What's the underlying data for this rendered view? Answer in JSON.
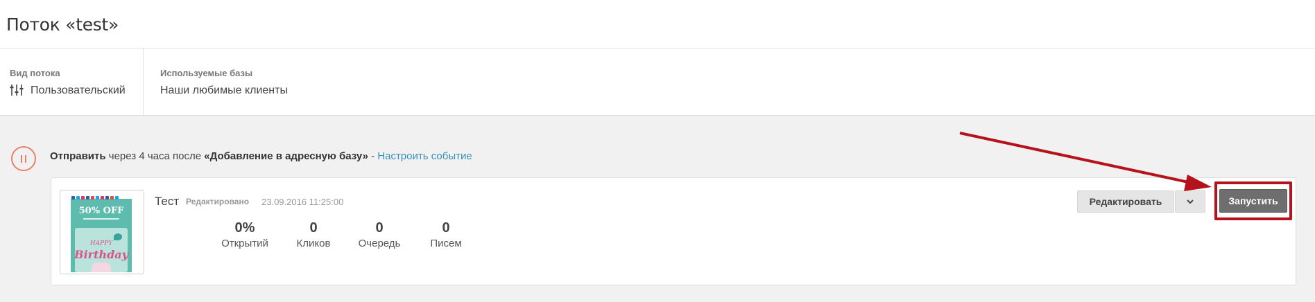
{
  "page": {
    "title": "Поток «test»"
  },
  "flow_info": {
    "type_label": "Вид потока",
    "type_value": "Пользовательский",
    "type_icon": "sliders-icon",
    "bases_label": "Используемые базы",
    "bases_value": "Наши любимые клиенты"
  },
  "event": {
    "status_icon": "pause-icon",
    "action": "Отправить",
    "delay_text": " через 4 часа после ",
    "trigger": "«Добавление в адресную базу»",
    "separator": " - ",
    "configure_link": "Настроить событие"
  },
  "email_card": {
    "name": "Тест",
    "edited_label": "Редактировано",
    "edited_date": "23.09.2016 11:25:00",
    "thumbnail": {
      "offer_text": "50% OFF",
      "happy_text": "HAPPY",
      "birthday_text": "Birthday"
    },
    "stats": [
      {
        "value": "0%",
        "label": "Открытий"
      },
      {
        "value": "0",
        "label": "Кликов"
      },
      {
        "value": "0",
        "label": "Очередь"
      },
      {
        "value": "0",
        "label": "Писем"
      }
    ],
    "edit_button": "Редактировать",
    "dropdown_icon": "chevron-down-icon",
    "start_button": "Запустить"
  },
  "colors": {
    "accent_link": "#3a8fb7",
    "pause_icon": "#e8806a",
    "annotation_red": "#b5121b",
    "start_button_bg": "#6e6e6e",
    "gray_background": "#f1f1f1"
  }
}
